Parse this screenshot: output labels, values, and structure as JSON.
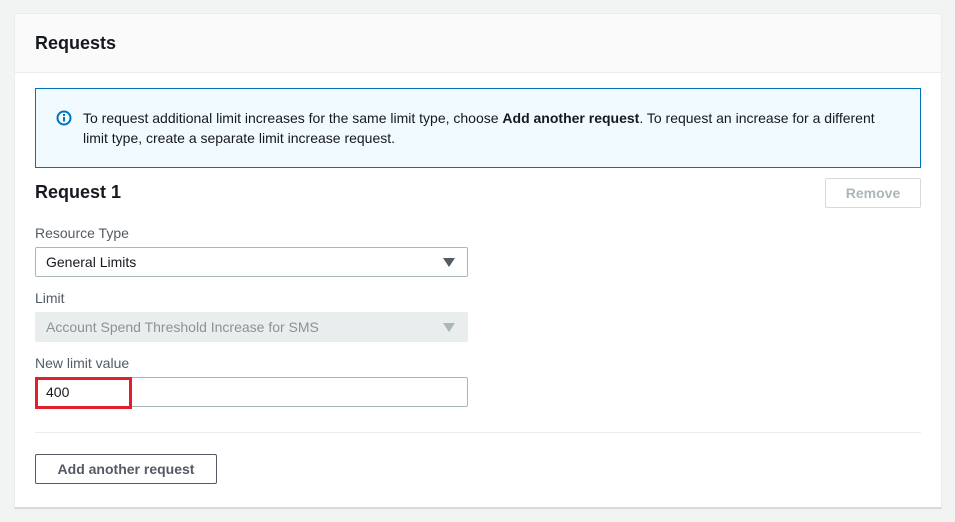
{
  "panel": {
    "title": "Requests"
  },
  "alert": {
    "icon": "info-icon",
    "text_before": "To request additional limit increases for the same limit type, choose ",
    "text_bold": "Add another request",
    "text_after": ". To request an increase for a different limit type, create a separate limit increase request."
  },
  "request": {
    "title": "Request 1",
    "remove_label": "Remove",
    "resource_type": {
      "label": "Resource Type",
      "value": "General Limits"
    },
    "limit": {
      "label": "Limit",
      "value": "Account Spend Threshold Increase for SMS"
    },
    "new_limit": {
      "label": "New limit value",
      "value": "400"
    }
  },
  "add_label": "Add another request",
  "colors": {
    "info_blue": "#0073bb",
    "highlight_red": "#e0202c",
    "border": "#aab7b8"
  }
}
